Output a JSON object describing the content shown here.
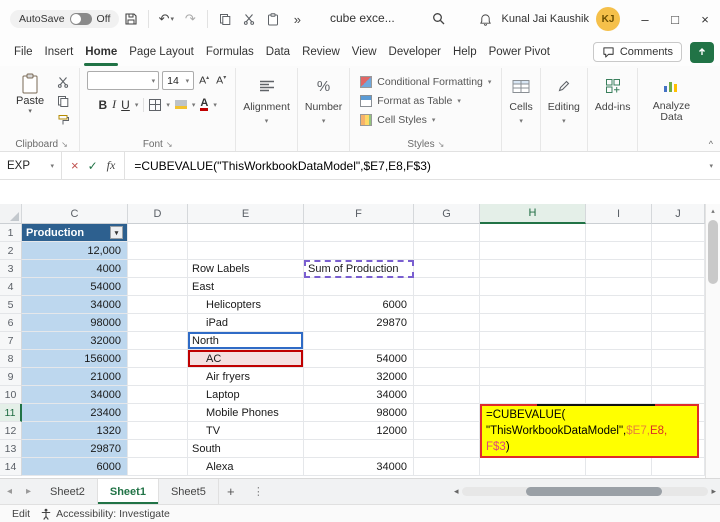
{
  "titlebar": {
    "autosave_label": "AutoSave",
    "autosave_state": "Off",
    "doc_title": "cube exce...",
    "user_name": "Kunal Jai Kaushik",
    "user_initials": "KJ"
  },
  "menubar": {
    "tabs": [
      {
        "label": "File",
        "active": false
      },
      {
        "label": "Insert",
        "active": false
      },
      {
        "label": "Home",
        "active": true
      },
      {
        "label": "Page Layout",
        "active": false
      },
      {
        "label": "Formulas",
        "active": false
      },
      {
        "label": "Data",
        "active": false
      },
      {
        "label": "Review",
        "active": false
      },
      {
        "label": "View",
        "active": false
      },
      {
        "label": "Developer",
        "active": false
      },
      {
        "label": "Help",
        "active": false
      },
      {
        "label": "Power Pivot",
        "active": false
      }
    ],
    "comments_label": "Comments"
  },
  "ribbon": {
    "paste": "Paste",
    "clipboard": "Clipboard",
    "font_group": "Font",
    "font_size": "14",
    "alignment": "Alignment",
    "number": "Number",
    "conditional_formatting": "Conditional Formatting",
    "format_as_table": "Format as Table",
    "cell_styles": "Cell Styles",
    "styles_group": "Styles",
    "cells": "Cells",
    "editing": "Editing",
    "addins": "Add-ins",
    "analyze_data": "Analyze Data"
  },
  "formula_bar": {
    "name_box": "EXP",
    "formula": "=CUBEVALUE(\"ThisWorkbookDataModel\",$E7,E8,F$3)"
  },
  "grid": {
    "column_headers": [
      "C",
      "D",
      "E",
      "F",
      "G",
      "H",
      "I",
      "J"
    ],
    "active_column": "H",
    "active_row": 11,
    "rows": 14,
    "c1_header": "Production",
    "col_c": {
      "2": "12,000",
      "3": "4000",
      "4": "54000",
      "5": "34000",
      "6": "98000",
      "7": "32000",
      "8": "156000",
      "9": "21000",
      "10": "34000",
      "11": "23400",
      "12": "1320",
      "13": "29870",
      "14": "6000"
    },
    "col_e": {
      "3": "Row Labels",
      "4": "East",
      "5": "Helicopters",
      "6": "iPad",
      "7": "North",
      "8": "AC",
      "9": "Air fryers",
      "10": "Laptop",
      "11": "Mobile Phones",
      "12": "TV",
      "13": "South",
      "14": "Alexa"
    },
    "col_e_indent": [
      5,
      6,
      8,
      9,
      10,
      11,
      12,
      14
    ],
    "col_f": {
      "3": "Sum of Production",
      "5": "6000",
      "6": "29870",
      "8": "54000",
      "9": "32000",
      "10": "34000",
      "11": "98000",
      "12": "12000",
      "14": "34000"
    },
    "formula_overlay": {
      "lines": [
        [
          {
            "t": "=CUBEVALUE(",
            "c": "#000000"
          }
        ],
        [
          {
            "t": "\"ThisWorkbookDataModel\",",
            "c": "#000000"
          },
          {
            "t": "$E7,",
            "c": "#E8833A"
          },
          {
            "t": "E8,",
            "c": "#D93025"
          }
        ],
        [
          {
            "t": "F$3",
            "c": "#E0457B"
          },
          {
            "t": ")",
            "c": "#000000"
          }
        ]
      ]
    }
  },
  "sheet_tabs": {
    "tabs": [
      {
        "label": "Sheet2",
        "active": false
      },
      {
        "label": "Sheet1",
        "active": true
      },
      {
        "label": "Sheet5",
        "active": false
      }
    ],
    "add_label": "+"
  },
  "status_bar": {
    "mode": "Edit",
    "accessibility": "Accessibility: Investigate"
  },
  "icons": {
    "dropdown": "▾",
    "dropup": "▴",
    "undo": "↶",
    "redo": "↷",
    "overflow": "»",
    "cancel": "×",
    "check": "✓",
    "fx": "fx",
    "percent": "%",
    "bold": "B",
    "italic": "I",
    "underline": "U",
    "font_letter": "A",
    "launcher": "↘",
    "collapse": "^",
    "minimize": "–",
    "maximize": "□",
    "close": "×",
    "left_arrow": "◂",
    "right_arrow": "▸",
    "more_vert": "⋮"
  },
  "colors": {
    "accent": "#217346",
    "band": "#BDD7EE",
    "c_header_bg": "#2D608F",
    "highlight": "#FFFF00",
    "overlay_border": "#E02B2B",
    "north_border": "#2F6BC6",
    "ac_border": "#C00000",
    "ac_fill": "#F5E0E0",
    "sum_border": "#7A5FD0"
  }
}
